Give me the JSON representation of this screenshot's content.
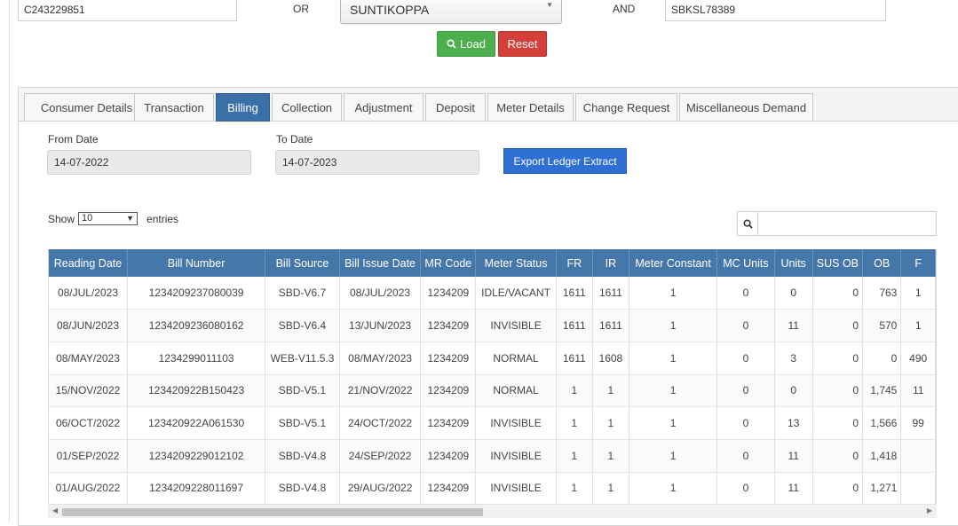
{
  "search": {
    "consumer_id": "C243229851",
    "or_label": "OR",
    "location_selected": "SUNTIKOPPA",
    "and_label": "AND",
    "meter_id": "SBKSL78389"
  },
  "buttons": {
    "load": "Load",
    "reset": "Reset",
    "export": "Export Ledger Extract"
  },
  "tabs": [
    "Consumer Details",
    "Transaction",
    "Billing",
    "Collection",
    "Adjustment",
    "Deposit",
    "Meter Details",
    "Change Request",
    "Miscellaneous Demand"
  ],
  "active_tab": "Billing",
  "filters": {
    "from_label": "From Date",
    "from_value": "14-07-2022",
    "to_label": "To Date",
    "to_value": "14-07-2023"
  },
  "length_menu": {
    "show_label": "Show",
    "value": "10",
    "entries_label": "entries"
  },
  "table": {
    "columns": [
      "Reading Date",
      "Bill Number",
      "Bill Source",
      "Bill Issue Date",
      "MR Code",
      "Meter Status",
      "FR",
      "IR",
      "Meter Constant",
      "MC Units",
      "Units",
      "SUS OB",
      "OB",
      "F"
    ],
    "rows": [
      [
        "08/JUL/2023",
        "1234209237080039",
        "SBD-V6.7",
        "08/JUL/2023",
        "1234209",
        "IDLE/VACANT",
        "1611",
        "1611",
        "1",
        "0",
        "0",
        "0",
        "763",
        "1"
      ],
      [
        "08/JUN/2023",
        "1234209236080162",
        "SBD-V6.4",
        "13/JUN/2023",
        "1234209",
        "INVISIBLE",
        "1611",
        "1611",
        "1",
        "0",
        "11",
        "0",
        "570",
        "1"
      ],
      [
        "08/MAY/2023",
        "1234299011103",
        "WEB-V11.5.3",
        "08/MAY/2023",
        "1234209",
        "NORMAL",
        "1611",
        "1608",
        "1",
        "0",
        "3",
        "0",
        "0",
        "490"
      ],
      [
        "15/NOV/2022",
        "123420922B150423",
        "SBD-V5.1",
        "21/NOV/2022",
        "1234209",
        "NORMAL",
        "1",
        "1",
        "1",
        "0",
        "0",
        "0",
        "1,745",
        "11"
      ],
      [
        "06/OCT/2022",
        "123420922A061530",
        "SBD-V5.1",
        "24/OCT/2022",
        "1234209",
        "INVISIBLE",
        "1",
        "1",
        "1",
        "0",
        "13",
        "0",
        "1,566",
        "99"
      ],
      [
        "01/SEP/2022",
        "1234209229012102",
        "SBD-V4.8",
        "24/SEP/2022",
        "1234209",
        "INVISIBLE",
        "1",
        "1",
        "1",
        "0",
        "11",
        "0",
        "1,418",
        ""
      ],
      [
        "01/AUG/2022",
        "1234209228011697",
        "SBD-V4.8",
        "29/AUG/2022",
        "1234209",
        "INVISIBLE",
        "1",
        "1",
        "1",
        "0",
        "11",
        "0",
        "1,271",
        ""
      ]
    ]
  },
  "colors": {
    "header_bg": "#4677a9",
    "active_tab": "#3a6fa8",
    "load_btn": "#4cae4c",
    "reset_btn": "#d43f3a",
    "export_btn": "#2e6fd3"
  }
}
